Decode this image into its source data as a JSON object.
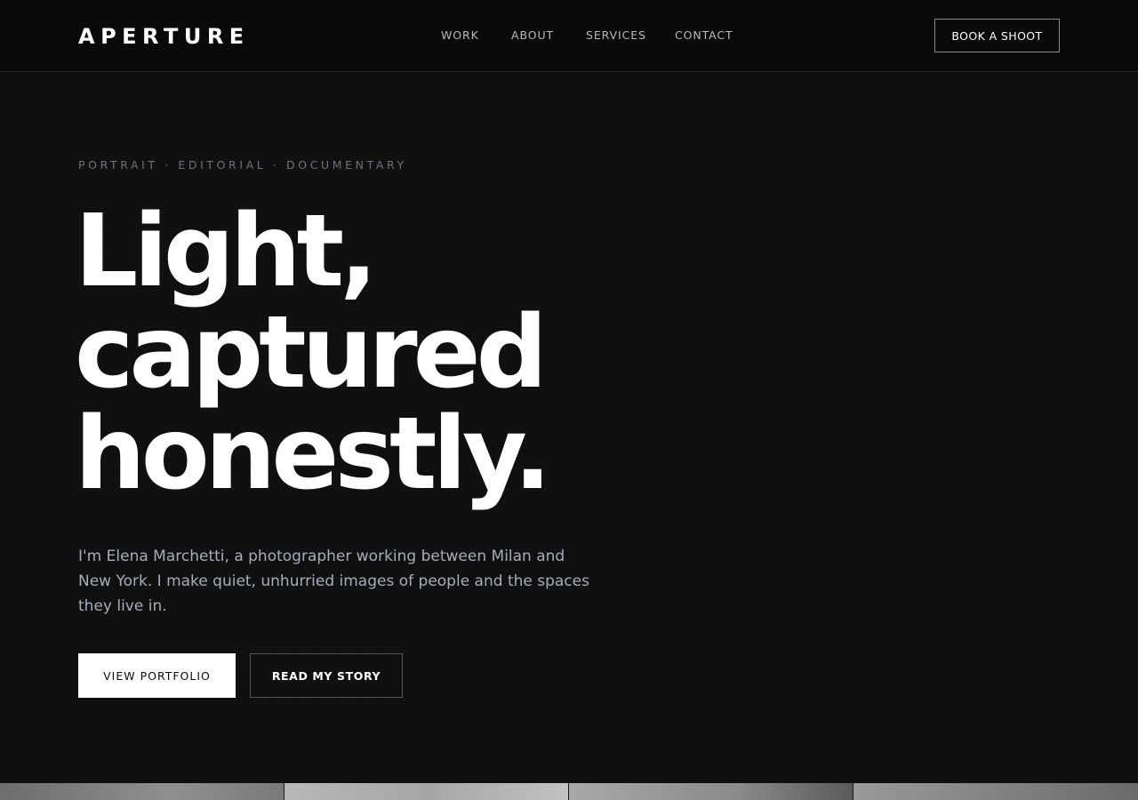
{
  "header": {
    "logo": "APERTURE",
    "nav": [
      {
        "label": "WORK"
      },
      {
        "label": "ABOUT"
      },
      {
        "label": "SERVICES"
      },
      {
        "label": "CONTACT"
      }
    ],
    "cta_label": "BOOK A SHOOT"
  },
  "hero": {
    "eyebrow": "PORTRAIT · EDITORIAL · DOCUMENTARY",
    "headline_lines": [
      "Light,",
      "captured",
      "honestly."
    ],
    "intro": "I'm Elena Marchetti, a photographer working between Milan and New York. I make quiet, unhurried images of people and the spaces they live in.",
    "primary_button": "VIEW PORTFOLIO",
    "secondary_button": "READ MY STORY"
  },
  "colors": {
    "background": "#0e0e0e",
    "text": "#ffffff",
    "muted": "#a6adba",
    "eyebrow": "#6e7280"
  }
}
